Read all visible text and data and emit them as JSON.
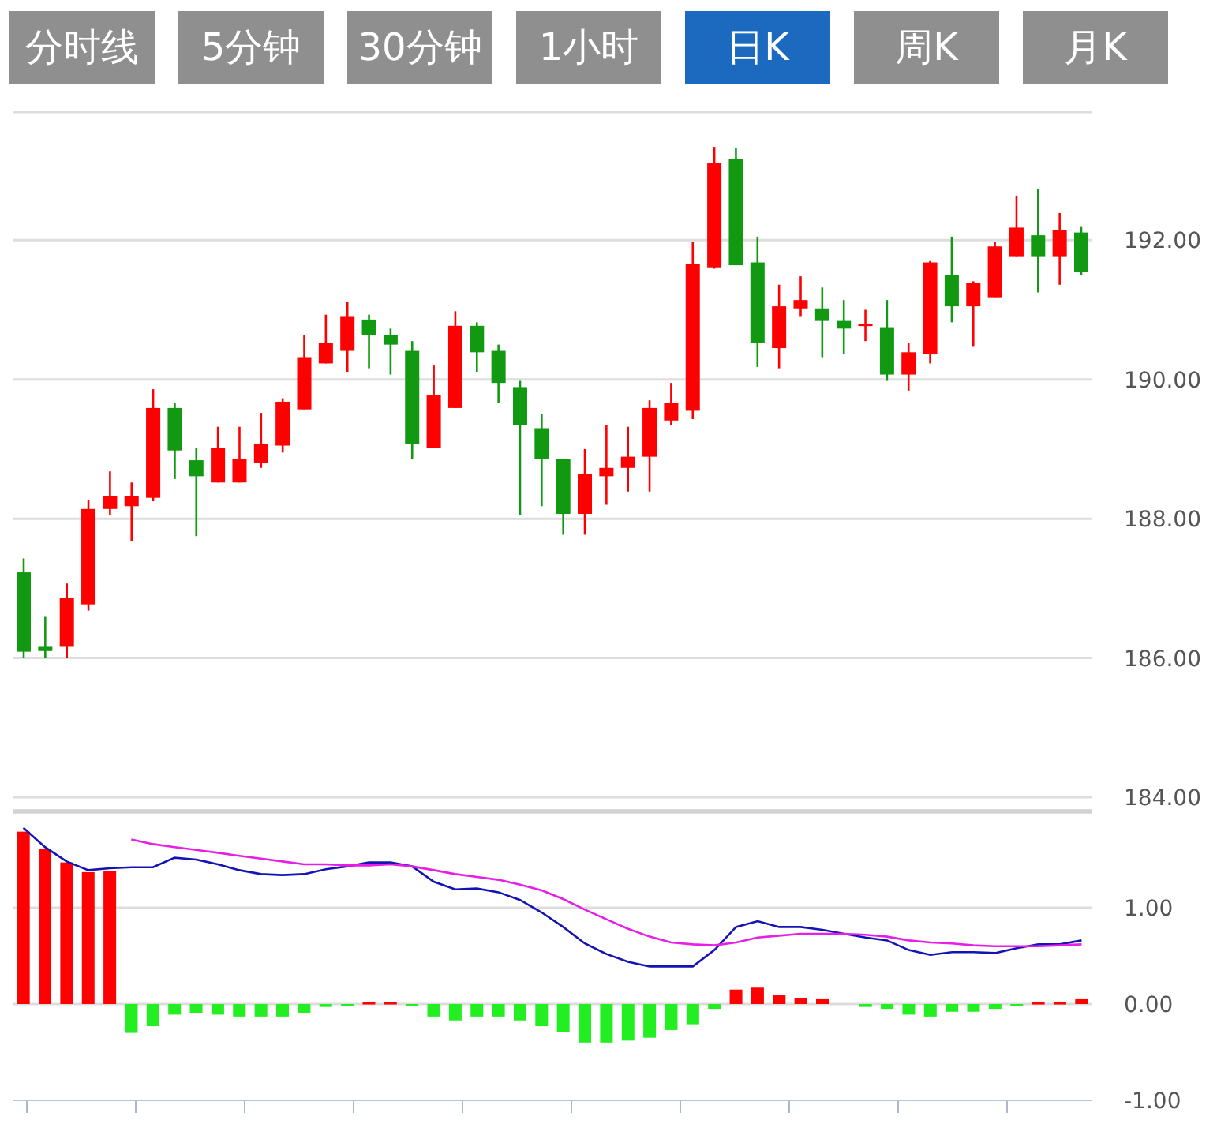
{
  "tabs": [
    {
      "label": "分时线",
      "selected": false
    },
    {
      "label": "5分钟",
      "selected": false
    },
    {
      "label": "30分钟",
      "selected": false
    },
    {
      "label": "1小时",
      "selected": false
    },
    {
      "label": "日K",
      "selected": true
    },
    {
      "label": "周K",
      "selected": false
    },
    {
      "label": "月K",
      "selected": false
    }
  ],
  "price_chart": {
    "chart_data": {
      "type": "candlestick",
      "grid": true,
      "ylim": [
        184,
        193.84
      ],
      "yticks": [
        {
          "value": 192,
          "label": "192.00"
        },
        {
          "value": 190,
          "label": "190.00"
        },
        {
          "value": 188,
          "label": "188.00"
        },
        {
          "value": 186,
          "label": "186.00"
        },
        {
          "value": 184,
          "label": "184.00"
        }
      ],
      "ohlc": [
        [
          187.23,
          187.43,
          186.0,
          186.09
        ],
        [
          186.16,
          186.59,
          186.0,
          186.1
        ],
        [
          186.16,
          187.07,
          186.0,
          186.86
        ],
        [
          186.77,
          188.27,
          186.68,
          188.14
        ],
        [
          188.14,
          188.68,
          188.05,
          188.32
        ],
        [
          188.18,
          188.52,
          187.68,
          188.32
        ],
        [
          188.3,
          189.86,
          188.25,
          189.59
        ],
        [
          189.59,
          189.66,
          188.57,
          188.98
        ],
        [
          188.84,
          189.02,
          187.75,
          188.61
        ],
        [
          188.52,
          189.32,
          188.52,
          189.02
        ],
        [
          188.52,
          189.32,
          188.52,
          188.86
        ],
        [
          188.8,
          189.52,
          188.73,
          189.07
        ],
        [
          189.05,
          189.73,
          188.95,
          189.68
        ],
        [
          189.57,
          190.64,
          189.57,
          190.32
        ],
        [
          190.23,
          190.93,
          190.23,
          190.52
        ],
        [
          190.41,
          191.11,
          190.11,
          190.91
        ],
        [
          190.86,
          190.93,
          190.16,
          190.64
        ],
        [
          190.64,
          190.73,
          190.07,
          190.5
        ],
        [
          190.41,
          190.55,
          188.86,
          189.07
        ],
        [
          189.02,
          190.2,
          189.02,
          189.77
        ],
        [
          189.59,
          190.98,
          189.59,
          190.77
        ],
        [
          190.77,
          190.82,
          190.11,
          190.39
        ],
        [
          190.41,
          190.5,
          189.66,
          189.95
        ],
        [
          189.89,
          189.98,
          188.05,
          189.34
        ],
        [
          189.3,
          189.5,
          188.18,
          188.86
        ],
        [
          188.86,
          188.86,
          187.77,
          188.07
        ],
        [
          188.07,
          189.0,
          187.77,
          188.64
        ],
        [
          188.61,
          189.34,
          188.2,
          188.73
        ],
        [
          188.73,
          189.32,
          188.39,
          188.89
        ],
        [
          188.89,
          189.7,
          188.39,
          189.59
        ],
        [
          189.41,
          189.95,
          189.34,
          189.66
        ],
        [
          189.55,
          191.98,
          189.43,
          191.66
        ],
        [
          191.61,
          193.34,
          191.59,
          193.11
        ],
        [
          193.16,
          193.32,
          191.64,
          191.64
        ],
        [
          191.68,
          192.05,
          190.18,
          190.52
        ],
        [
          190.45,
          191.36,
          190.16,
          191.05
        ],
        [
          191.02,
          191.48,
          190.91,
          191.14
        ],
        [
          191.02,
          191.32,
          190.32,
          190.84
        ],
        [
          190.84,
          191.14,
          190.36,
          190.73
        ],
        [
          190.77,
          191.0,
          190.55,
          190.8
        ],
        [
          190.75,
          191.14,
          189.98,
          190.07
        ],
        [
          190.07,
          190.52,
          189.84,
          190.39
        ],
        [
          190.36,
          191.7,
          190.23,
          191.68
        ],
        [
          191.5,
          192.05,
          190.82,
          191.05
        ],
        [
          191.05,
          191.41,
          190.48,
          191.39
        ],
        [
          191.18,
          191.98,
          191.18,
          191.91
        ],
        [
          191.77,
          192.64,
          191.77,
          192.18
        ],
        [
          192.07,
          192.73,
          191.25,
          191.77
        ],
        [
          191.77,
          192.39,
          191.36,
          192.14
        ],
        [
          192.11,
          192.2,
          191.5,
          191.55
        ]
      ]
    }
  },
  "indicator_chart": {
    "histogram": {
      "chart_data": {
        "type": "bar",
        "grid": true,
        "ylim": [
          -1,
          2
        ],
        "yticks": [
          {
            "value": 1,
            "label": "1.00"
          },
          {
            "value": 0,
            "label": "0.00"
          },
          {
            "value": -1,
            "label": "-1.00"
          }
        ],
        "values": [
          1.79,
          1.61,
          1.47,
          1.37,
          1.38,
          -0.3,
          -0.23,
          -0.11,
          -0.09,
          -0.11,
          -0.13,
          -0.13,
          -0.13,
          -0.09,
          -0.03,
          -0.02,
          0.02,
          0.02,
          -0.02,
          -0.13,
          -0.17,
          -0.13,
          -0.13,
          -0.17,
          -0.23,
          -0.29,
          -0.4,
          -0.4,
          -0.38,
          -0.35,
          -0.27,
          -0.21,
          -0.05,
          0.15,
          0.17,
          0.09,
          0.06,
          0.05,
          0.0,
          -0.03,
          -0.05,
          -0.11,
          -0.13,
          -0.08,
          -0.08,
          -0.05,
          -0.02,
          0.02,
          0.02,
          0.05
        ]
      }
    },
    "lines": {
      "chart_data": {
        "type": "line",
        "ylim": [
          -1,
          2
        ],
        "series": [
          {
            "color": "#1414b4",
            "values": [
              1.83,
              1.63,
              1.48,
              1.39,
              1.41,
              1.42,
              1.42,
              1.52,
              1.5,
              1.45,
              1.39,
              1.35,
              1.34,
              1.35,
              1.4,
              1.43,
              1.47,
              1.47,
              1.43,
              1.27,
              1.19,
              1.2,
              1.16,
              1.08,
              0.95,
              0.8,
              0.63,
              0.52,
              0.44,
              0.39,
              0.39,
              0.39,
              0.56,
              0.8,
              0.86,
              0.8,
              0.8,
              0.77,
              0.73,
              0.69,
              0.66,
              0.56,
              0.51,
              0.54,
              0.54,
              0.53,
              0.58,
              0.62,
              0.62,
              0.66
            ]
          },
          {
            "color": "#e61ee6",
            "values": [
              null,
              null,
              null,
              null,
              null,
              1.71,
              1.66,
              1.63,
              1.6,
              1.57,
              1.54,
              1.51,
              1.48,
              1.45,
              1.45,
              1.44,
              1.44,
              1.45,
              1.43,
              1.39,
              1.35,
              1.32,
              1.29,
              1.24,
              1.18,
              1.09,
              0.98,
              0.88,
              0.78,
              0.7,
              0.64,
              0.62,
              0.61,
              0.64,
              0.69,
              0.71,
              0.73,
              0.73,
              0.73,
              0.72,
              0.7,
              0.66,
              0.64,
              0.63,
              0.61,
              0.6,
              0.6,
              0.6,
              0.61,
              0.62
            ]
          }
        ]
      }
    }
  }
}
